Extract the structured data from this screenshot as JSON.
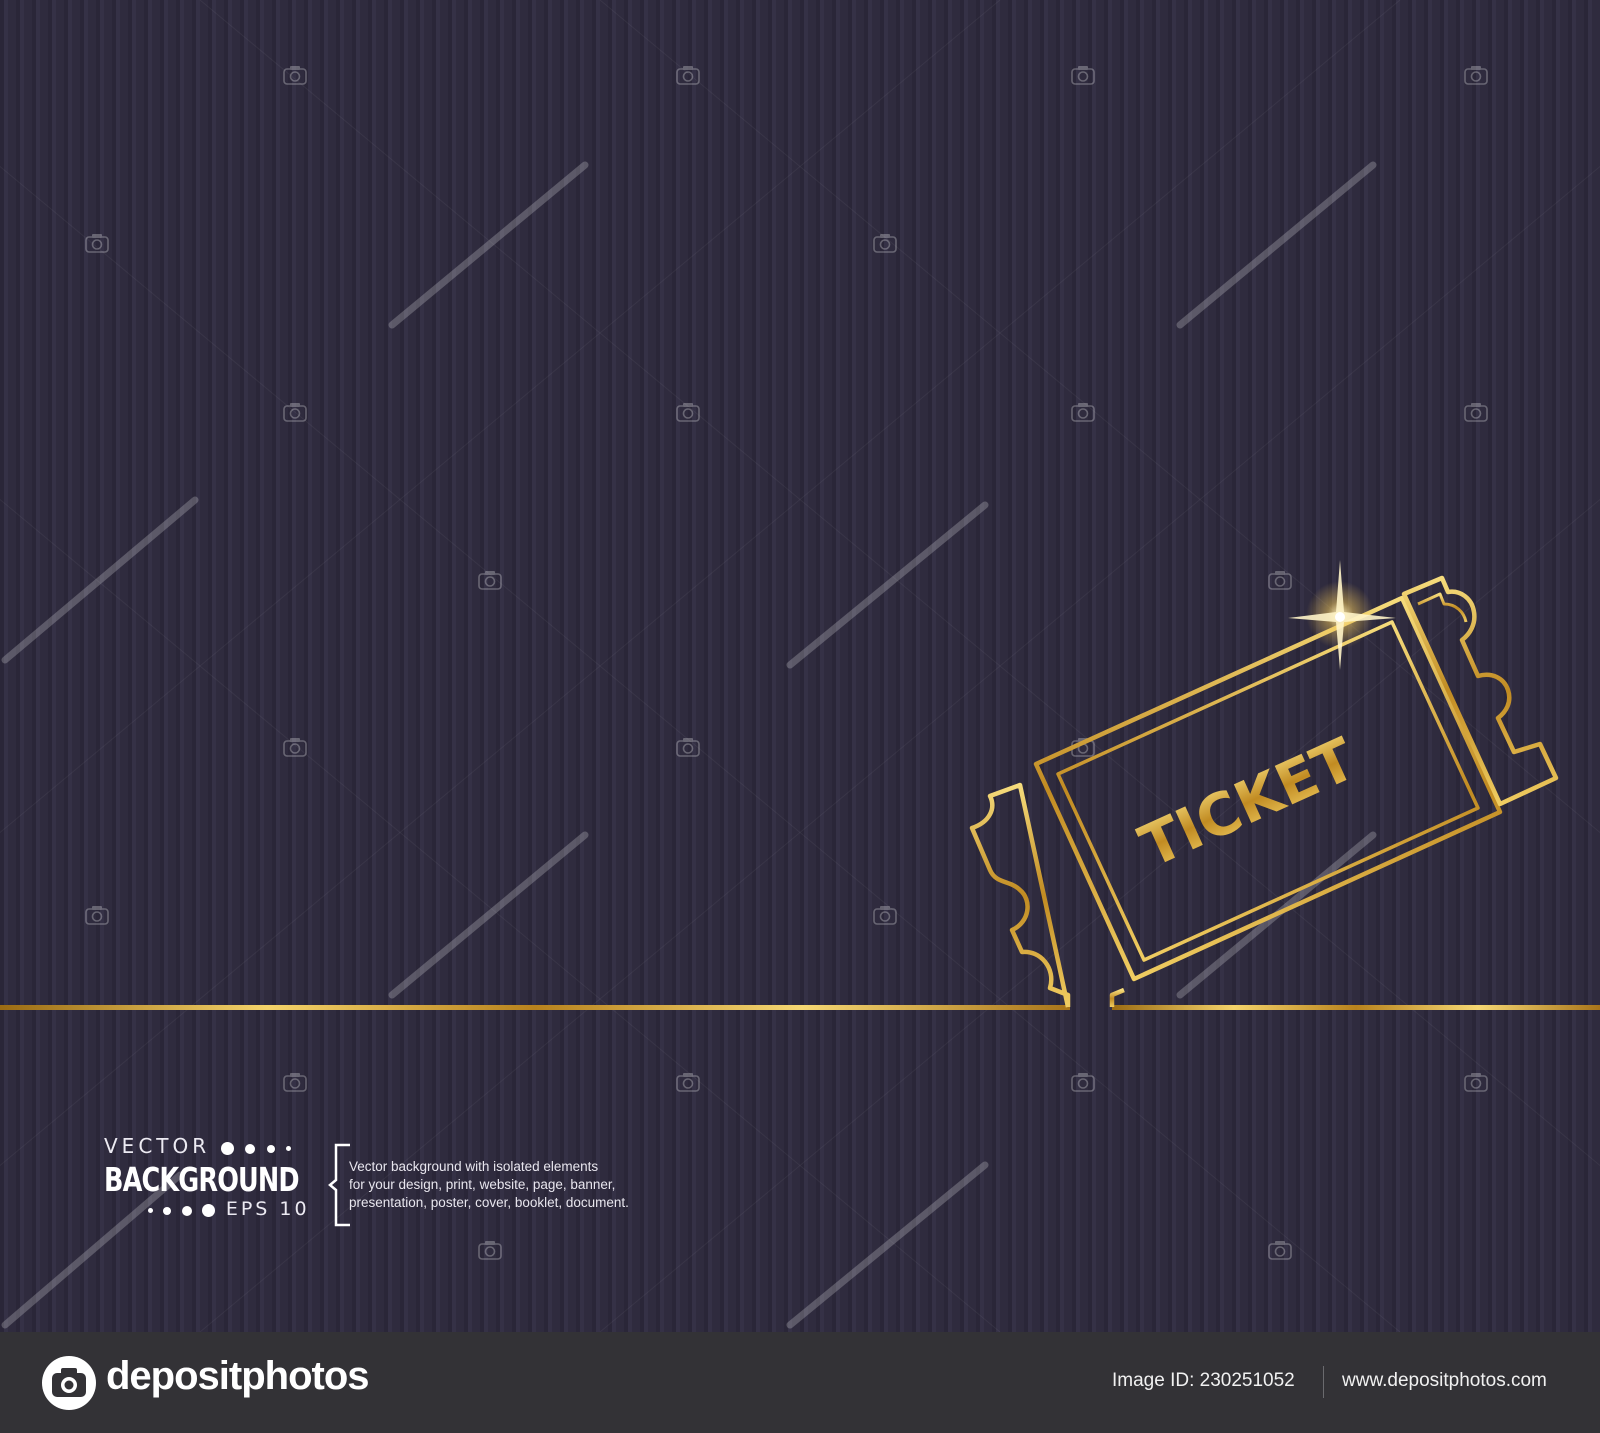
{
  "ticket": {
    "label": "TICKET"
  },
  "badge": {
    "line1": "VECTOR",
    "line2": "BACKGROUND",
    "line3": "EPS 10"
  },
  "description": {
    "lines": [
      "Vector background with isolated elements",
      "for your design, print, website, page, banner,",
      "presentation, poster, cover, booklet, document."
    ]
  },
  "footer": {
    "brand": "depositphotos",
    "image_id": "Image ID: 230251052",
    "url": "www.depositphotos.com"
  },
  "colors": {
    "background": "#2f2b3e",
    "gold": "#d9a632",
    "footer": "#333236"
  },
  "icons": [
    "camera-logo-icon",
    "camera-watermark-icon",
    "sparkle-icon"
  ]
}
